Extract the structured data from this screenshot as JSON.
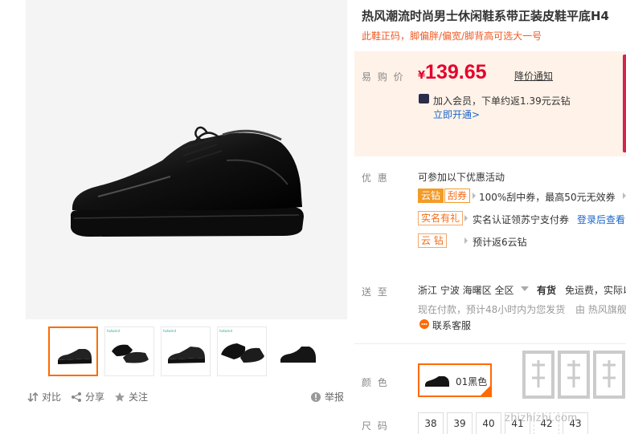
{
  "product": {
    "title": "热风潮流时尚男士休闲鞋系带正装皮鞋平底H4",
    "subtitle": "此鞋正码，脚偏胖/偏宽/脚背高可选大一号"
  },
  "gallery": {
    "thumb_tag": "hotwind"
  },
  "actions": {
    "compare": "对比",
    "share": "分享",
    "follow": "关注",
    "report": "举报"
  },
  "price": {
    "label": "易 购 价",
    "currency": "¥",
    "value": "139.65",
    "notify": "降价通知",
    "vip_text": "加入会员，下单约返1.39元云钻",
    "vip_link": "立即开通>"
  },
  "promo": {
    "label": "优  惠",
    "intro": "可参加以下优惠活动",
    "items": [
      {
        "tag1": "云钻",
        "tag2": "刮券",
        "text": "100%刮中券，最高50元无效券"
      },
      {
        "tag1": "实名有礼",
        "text": "实名认证领苏宁支付券",
        "link": "登录后查看"
      },
      {
        "tag1": "云 钻",
        "text": "预计返6云钻"
      }
    ]
  },
  "delivery": {
    "label": "送  至",
    "location": "浙江  宁波  海曙区  全区",
    "stock": "有货",
    "shipping": "免运费，实际以",
    "eta": "现在付款，预计48小时内为您发货",
    "seller": "由  热风旗舰",
    "service": "联系客服"
  },
  "color": {
    "label": "颜  色",
    "selected": "01黑色"
  },
  "size": {
    "label": "尺  码",
    "options": [
      "38",
      "39",
      "40",
      "41",
      "42",
      "43"
    ]
  },
  "watermark": {
    "text": "zhizhizhi.com"
  },
  "colors": {
    "accent": "#ff6a00",
    "price": "#e4002b",
    "link": "#1b66c9",
    "price_bg": "#fff2e8"
  }
}
